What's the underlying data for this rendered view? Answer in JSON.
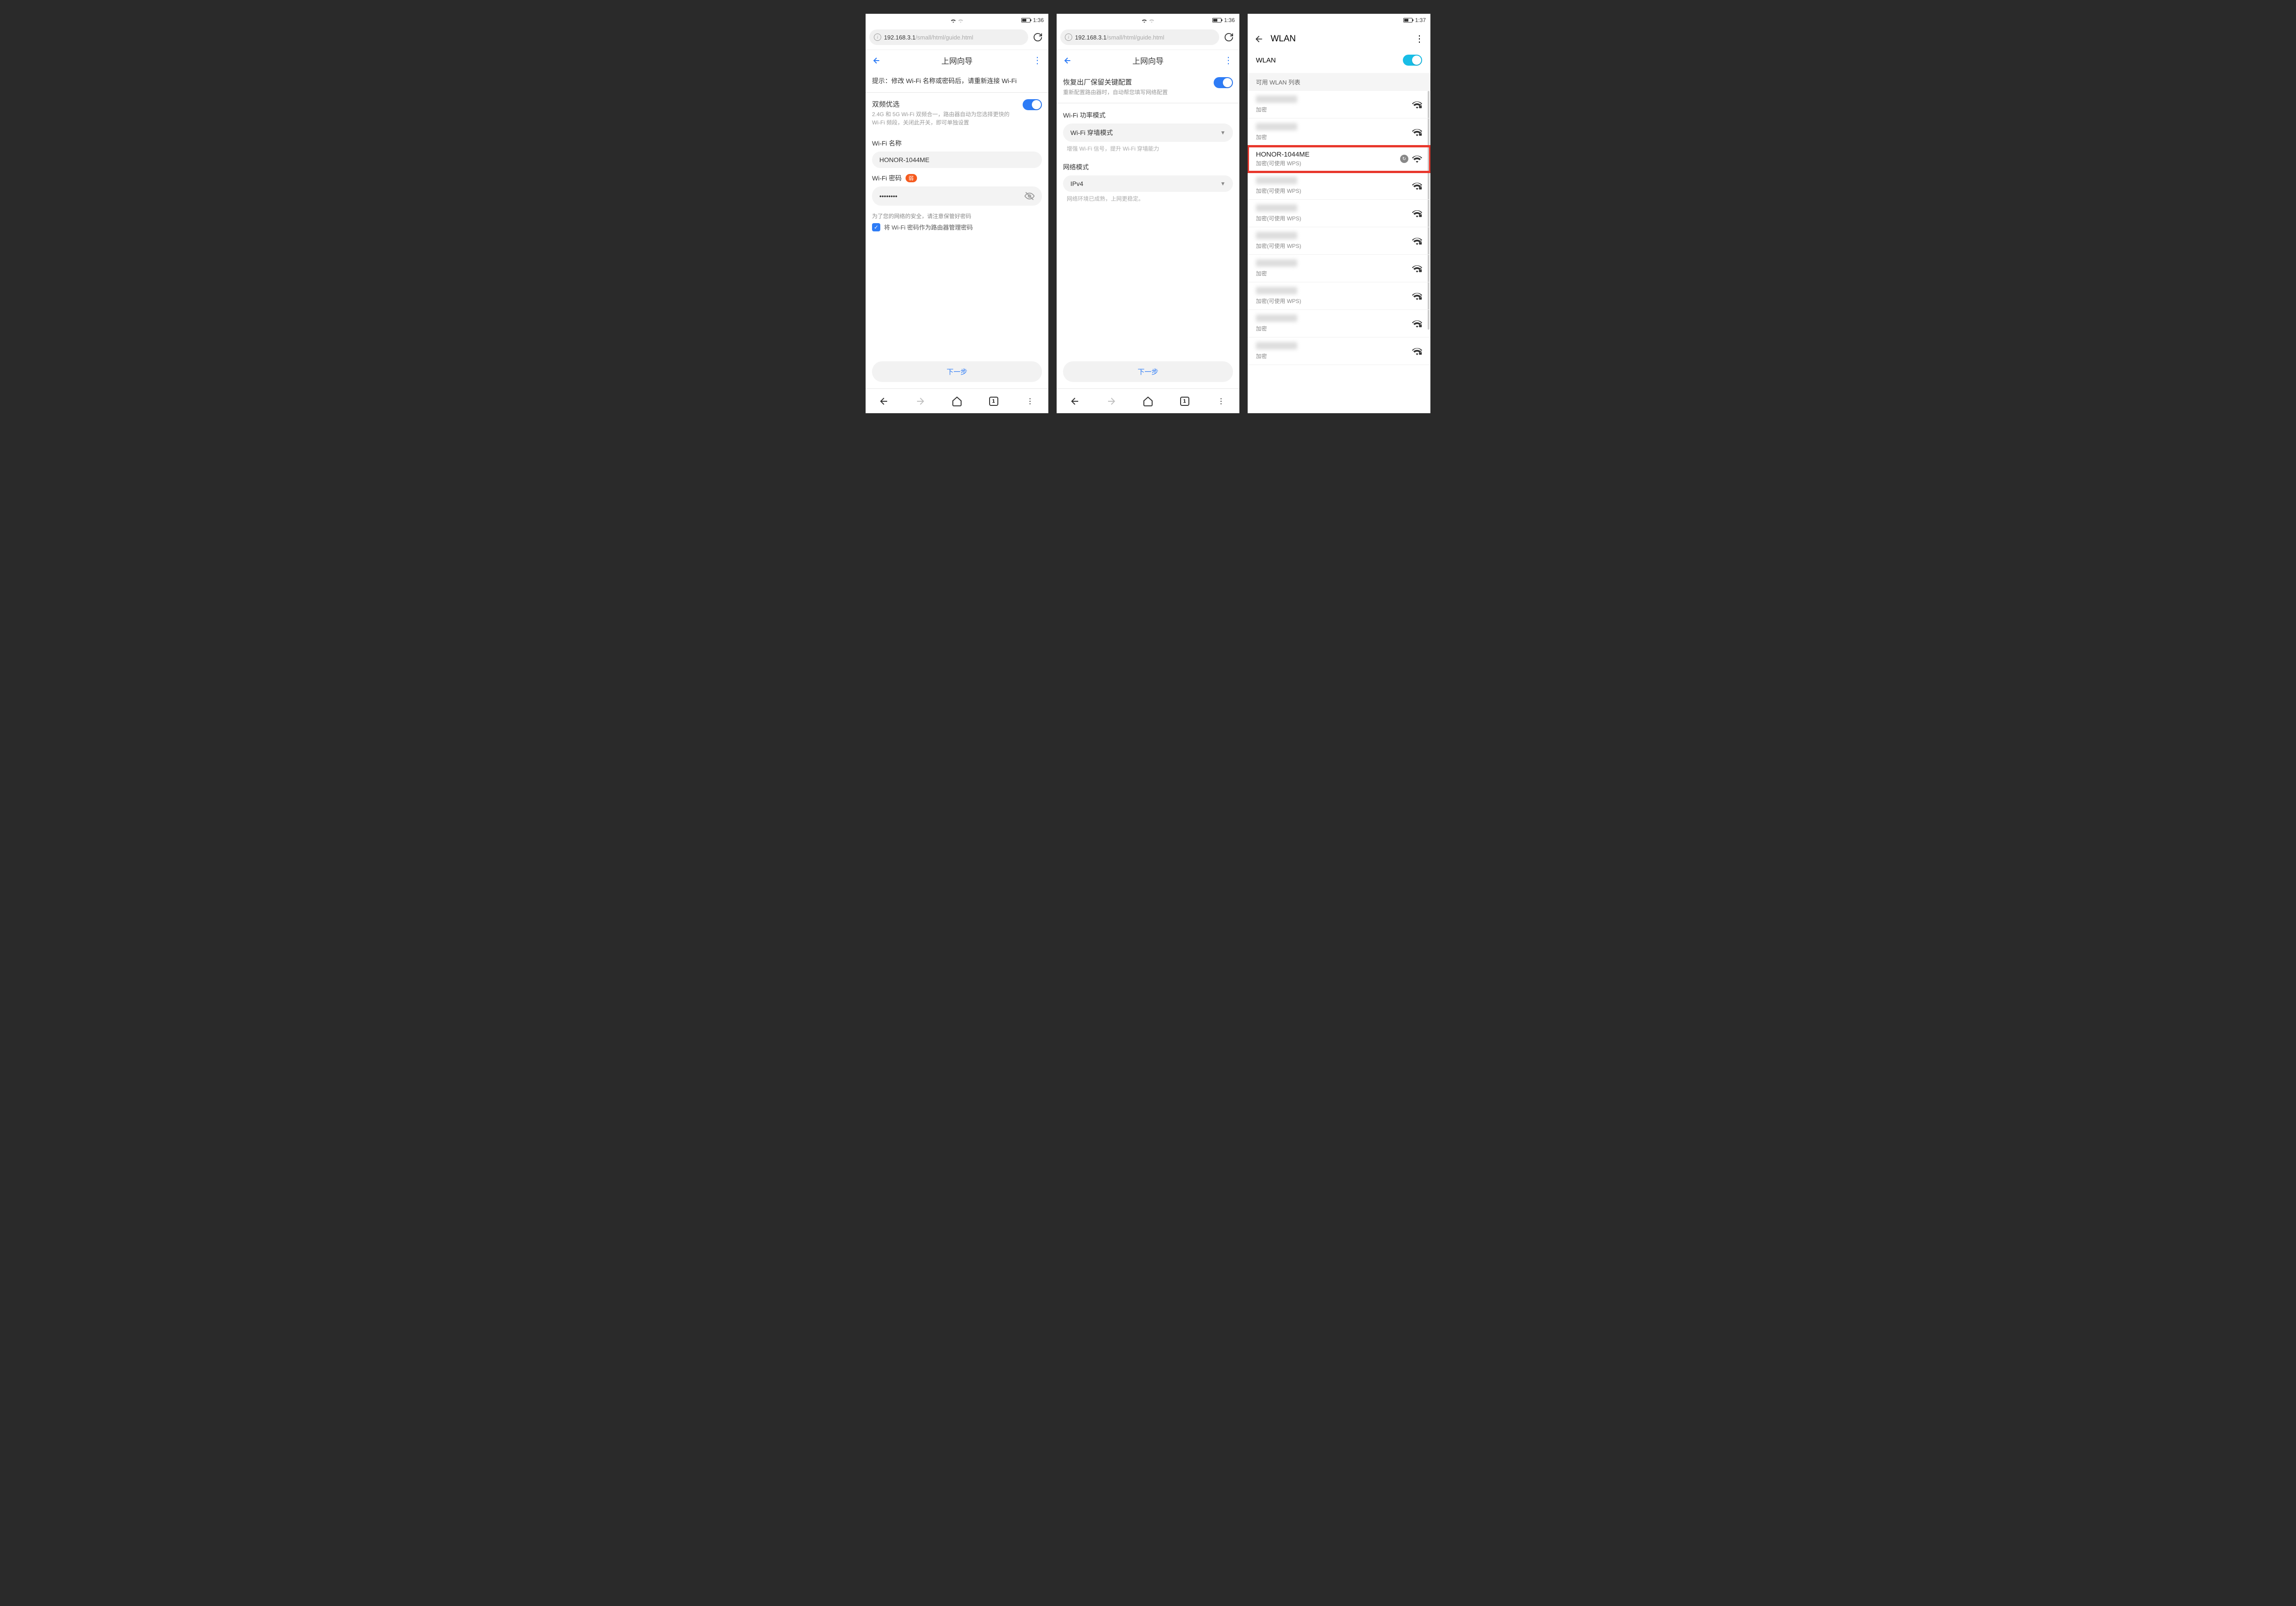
{
  "screen1": {
    "status": {
      "time": "1:36"
    },
    "url_host": "192.168.3.1",
    "url_path": "/small/html/guide.html",
    "page_title": "上网向导",
    "hint": "提示：修改 Wi-Fi 名称或密码后，请重新连接 Wi-Fi",
    "dualband": {
      "title": "双频优选",
      "desc": "2.4G 和 5G Wi-Fi 双频合一，路由器自动为您选择更快的 Wi-Fi 频段，关闭此开关，即可单独设置"
    },
    "wifi_name_label": "Wi-Fi 名称",
    "wifi_name_value": "HONOR-1044ME",
    "wifi_pwd_label": "Wi-Fi 密码",
    "wifi_pwd_badge": "弱",
    "wifi_pwd_value": "••••••••",
    "pwd_tip": "为了您的网络的安全，请注意保管好密码",
    "checkbox_label": "将 Wi-Fi 密码作为路由器管理密码",
    "next": "下一步",
    "tab_count": "1"
  },
  "screen2": {
    "status": {
      "time": "1:36"
    },
    "url_host": "192.168.3.1",
    "url_path": "/small/html/guide.html",
    "page_title": "上网向导",
    "restore": {
      "title": "恢复出厂保留关键配置",
      "desc": "重新配置路由器时，自动帮您填写网络配置"
    },
    "power_mode_label": "Wi-Fi 功率模式",
    "power_mode_value": "Wi-Fi 穿墙模式",
    "power_mode_help": "增强 Wi-Fi 信号，提升 Wi-Fi 穿墙能力",
    "net_mode_label": "网络模式",
    "net_mode_value": "IPv4",
    "net_mode_help": "网络环境已成熟，上网更稳定。",
    "next": "下一步",
    "tab_count": "1"
  },
  "screen3": {
    "status": {
      "time": "1:37"
    },
    "header_title": "WLAN",
    "toggle_label": "WLAN",
    "section_header": "可用 WLAN 列表",
    "networks": [
      {
        "ssid_hidden": true,
        "sub": "加密",
        "wps": false,
        "locked": true
      },
      {
        "ssid_hidden": true,
        "sub": "加密",
        "wps": false,
        "locked": true
      },
      {
        "ssid": "HONOR-1044ME",
        "sub": "加密(可使用 WPS)",
        "wps": true,
        "locked": false,
        "highlight": true,
        "link_badge": true
      },
      {
        "ssid_hidden": true,
        "sub": "加密(可使用 WPS)",
        "wps": true,
        "locked": true
      },
      {
        "ssid_hidden": true,
        "sub": "加密(可使用 WPS)",
        "wps": true,
        "locked": true
      },
      {
        "ssid_hidden": true,
        "sub": "加密(可使用 WPS)",
        "wps": true,
        "locked": true
      },
      {
        "ssid_hidden": true,
        "sub": "加密",
        "wps": false,
        "locked": true
      },
      {
        "ssid_hidden": true,
        "sub": "加密(可使用 WPS)",
        "wps": true,
        "locked": true
      },
      {
        "ssid_hidden": true,
        "sub": "加密",
        "wps": false,
        "locked": true
      },
      {
        "ssid_hidden": true,
        "sub": "加密",
        "wps": false,
        "locked": true
      }
    ]
  }
}
